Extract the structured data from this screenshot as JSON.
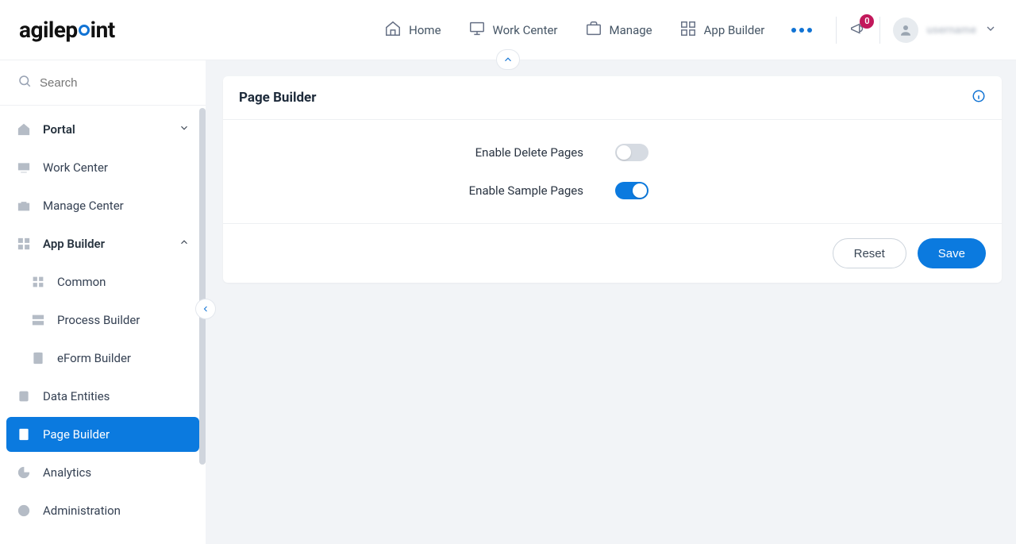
{
  "brand": {
    "name_left": "agilep",
    "name_right": "int"
  },
  "topnav": {
    "home": "Home",
    "work_center": "Work Center",
    "manage": "Manage",
    "app_builder": "App Builder"
  },
  "notifications": {
    "count": "0"
  },
  "profile": {
    "name": "username"
  },
  "search": {
    "placeholder": "Search"
  },
  "sidebar": {
    "portal": "Portal",
    "work_center": "Work Center",
    "manage_center": "Manage Center",
    "app_builder": "App Builder",
    "common": "Common",
    "process_builder": "Process Builder",
    "eform_builder": "eForm Builder",
    "data_entities": "Data Entities",
    "page_builder": "Page Builder",
    "analytics": "Analytics",
    "administration": "Administration"
  },
  "panel": {
    "title": "Page Builder",
    "enable_delete": "Enable Delete Pages",
    "enable_sample": "Enable Sample Pages",
    "reset": "Reset",
    "save": "Save"
  },
  "toggles": {
    "enable_delete": false,
    "enable_sample": true
  }
}
